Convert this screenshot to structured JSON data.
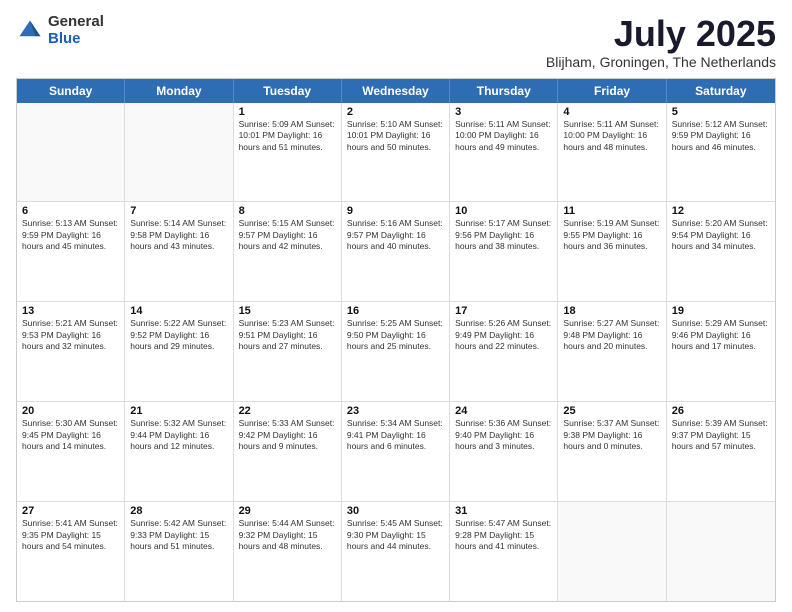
{
  "logo": {
    "general": "General",
    "blue": "Blue"
  },
  "title": "July 2025",
  "location": "Blijham, Groningen, The Netherlands",
  "header_days": [
    "Sunday",
    "Monday",
    "Tuesday",
    "Wednesday",
    "Thursday",
    "Friday",
    "Saturday"
  ],
  "weeks": [
    [
      {
        "day": "",
        "info": ""
      },
      {
        "day": "",
        "info": ""
      },
      {
        "day": "1",
        "info": "Sunrise: 5:09 AM\nSunset: 10:01 PM\nDaylight: 16 hours\nand 51 minutes."
      },
      {
        "day": "2",
        "info": "Sunrise: 5:10 AM\nSunset: 10:01 PM\nDaylight: 16 hours\nand 50 minutes."
      },
      {
        "day": "3",
        "info": "Sunrise: 5:11 AM\nSunset: 10:00 PM\nDaylight: 16 hours\nand 49 minutes."
      },
      {
        "day": "4",
        "info": "Sunrise: 5:11 AM\nSunset: 10:00 PM\nDaylight: 16 hours\nand 48 minutes."
      },
      {
        "day": "5",
        "info": "Sunrise: 5:12 AM\nSunset: 9:59 PM\nDaylight: 16 hours\nand 46 minutes."
      }
    ],
    [
      {
        "day": "6",
        "info": "Sunrise: 5:13 AM\nSunset: 9:59 PM\nDaylight: 16 hours\nand 45 minutes."
      },
      {
        "day": "7",
        "info": "Sunrise: 5:14 AM\nSunset: 9:58 PM\nDaylight: 16 hours\nand 43 minutes."
      },
      {
        "day": "8",
        "info": "Sunrise: 5:15 AM\nSunset: 9:57 PM\nDaylight: 16 hours\nand 42 minutes."
      },
      {
        "day": "9",
        "info": "Sunrise: 5:16 AM\nSunset: 9:57 PM\nDaylight: 16 hours\nand 40 minutes."
      },
      {
        "day": "10",
        "info": "Sunrise: 5:17 AM\nSunset: 9:56 PM\nDaylight: 16 hours\nand 38 minutes."
      },
      {
        "day": "11",
        "info": "Sunrise: 5:19 AM\nSunset: 9:55 PM\nDaylight: 16 hours\nand 36 minutes."
      },
      {
        "day": "12",
        "info": "Sunrise: 5:20 AM\nSunset: 9:54 PM\nDaylight: 16 hours\nand 34 minutes."
      }
    ],
    [
      {
        "day": "13",
        "info": "Sunrise: 5:21 AM\nSunset: 9:53 PM\nDaylight: 16 hours\nand 32 minutes."
      },
      {
        "day": "14",
        "info": "Sunrise: 5:22 AM\nSunset: 9:52 PM\nDaylight: 16 hours\nand 29 minutes."
      },
      {
        "day": "15",
        "info": "Sunrise: 5:23 AM\nSunset: 9:51 PM\nDaylight: 16 hours\nand 27 minutes."
      },
      {
        "day": "16",
        "info": "Sunrise: 5:25 AM\nSunset: 9:50 PM\nDaylight: 16 hours\nand 25 minutes."
      },
      {
        "day": "17",
        "info": "Sunrise: 5:26 AM\nSunset: 9:49 PM\nDaylight: 16 hours\nand 22 minutes."
      },
      {
        "day": "18",
        "info": "Sunrise: 5:27 AM\nSunset: 9:48 PM\nDaylight: 16 hours\nand 20 minutes."
      },
      {
        "day": "19",
        "info": "Sunrise: 5:29 AM\nSunset: 9:46 PM\nDaylight: 16 hours\nand 17 minutes."
      }
    ],
    [
      {
        "day": "20",
        "info": "Sunrise: 5:30 AM\nSunset: 9:45 PM\nDaylight: 16 hours\nand 14 minutes."
      },
      {
        "day": "21",
        "info": "Sunrise: 5:32 AM\nSunset: 9:44 PM\nDaylight: 16 hours\nand 12 minutes."
      },
      {
        "day": "22",
        "info": "Sunrise: 5:33 AM\nSunset: 9:42 PM\nDaylight: 16 hours\nand 9 minutes."
      },
      {
        "day": "23",
        "info": "Sunrise: 5:34 AM\nSunset: 9:41 PM\nDaylight: 16 hours\nand 6 minutes."
      },
      {
        "day": "24",
        "info": "Sunrise: 5:36 AM\nSunset: 9:40 PM\nDaylight: 16 hours\nand 3 minutes."
      },
      {
        "day": "25",
        "info": "Sunrise: 5:37 AM\nSunset: 9:38 PM\nDaylight: 16 hours\nand 0 minutes."
      },
      {
        "day": "26",
        "info": "Sunrise: 5:39 AM\nSunset: 9:37 PM\nDaylight: 15 hours\nand 57 minutes."
      }
    ],
    [
      {
        "day": "27",
        "info": "Sunrise: 5:41 AM\nSunset: 9:35 PM\nDaylight: 15 hours\nand 54 minutes."
      },
      {
        "day": "28",
        "info": "Sunrise: 5:42 AM\nSunset: 9:33 PM\nDaylight: 15 hours\nand 51 minutes."
      },
      {
        "day": "29",
        "info": "Sunrise: 5:44 AM\nSunset: 9:32 PM\nDaylight: 15 hours\nand 48 minutes."
      },
      {
        "day": "30",
        "info": "Sunrise: 5:45 AM\nSunset: 9:30 PM\nDaylight: 15 hours\nand 44 minutes."
      },
      {
        "day": "31",
        "info": "Sunrise: 5:47 AM\nSunset: 9:28 PM\nDaylight: 15 hours\nand 41 minutes."
      },
      {
        "day": "",
        "info": ""
      },
      {
        "day": "",
        "info": ""
      }
    ]
  ]
}
